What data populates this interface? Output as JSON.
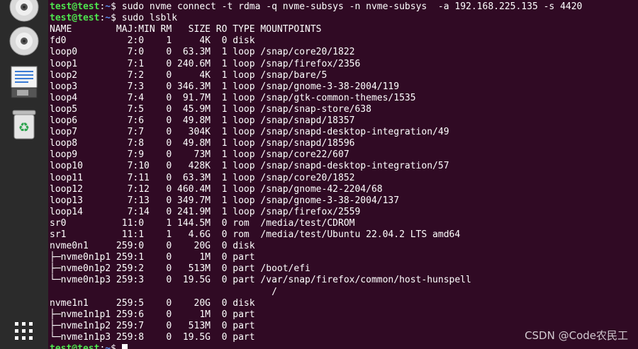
{
  "dock": {
    "items": [
      "optical-disc-icon",
      "optical-disc-icon",
      "disk-editor-icon",
      "trash-icon"
    ],
    "apps_grid_icon": "show-applications-icon"
  },
  "terminal": {
    "prompt_user": "test@test",
    "prompt_path": "~",
    "lines": [
      {
        "text": "sudo nvme connect -t rdma -q nvme-subsys -n nvme-subsys  -a 192.168.225.135 -s 4420",
        "prompt": true
      },
      {
        "text": "sudo lsblk",
        "prompt": true
      },
      {
        "text": "NAME        MAJ:MIN RM   SIZE RO TYPE MOUNTPOINTS"
      },
      {
        "text": "fd0           2:0    1     4K  0 disk"
      },
      {
        "text": "loop0         7:0    0  63.3M  1 loop /snap/core20/1822"
      },
      {
        "text": "loop1         7:1    0 240.6M  1 loop /snap/firefox/2356"
      },
      {
        "text": "loop2         7:2    0     4K  1 loop /snap/bare/5"
      },
      {
        "text": "loop3         7:3    0 346.3M  1 loop /snap/gnome-3-38-2004/119"
      },
      {
        "text": "loop4         7:4    0  91.7M  1 loop /snap/gtk-common-themes/1535"
      },
      {
        "text": "loop5         7:5    0  45.9M  1 loop /snap/snap-store/638"
      },
      {
        "text": "loop6         7:6    0  49.8M  1 loop /snap/snapd/18357"
      },
      {
        "text": "loop7         7:7    0   304K  1 loop /snap/snapd-desktop-integration/49"
      },
      {
        "text": "loop8         7:8    0  49.8M  1 loop /snap/snapd/18596"
      },
      {
        "text": "loop9         7:9    0    73M  1 loop /snap/core22/607"
      },
      {
        "text": "loop10        7:10   0   428K  1 loop /snap/snapd-desktop-integration/57"
      },
      {
        "text": "loop11        7:11   0  63.3M  1 loop /snap/core20/1852"
      },
      {
        "text": "loop12        7:12   0 460.4M  1 loop /snap/gnome-42-2204/68"
      },
      {
        "text": "loop13        7:13   0 349.7M  1 loop /snap/gnome-3-38-2004/137"
      },
      {
        "text": "loop14        7:14   0 241.9M  1 loop /snap/firefox/2559"
      },
      {
        "text": "sr0          11:0    1 144.5M  0 rom  /media/test/CDROM"
      },
      {
        "text": "sr1          11:1    1   4.6G  0 rom  /media/test/Ubuntu 22.04.2 LTS amd64"
      },
      {
        "text": "nvme0n1     259:0    0    20G  0 disk"
      },
      {
        "text": "├─nvme0n1p1 259:1    0     1M  0 part"
      },
      {
        "text": "├─nvme0n1p2 259:2    0   513M  0 part /boot/efi"
      },
      {
        "text": "└─nvme0n1p3 259:3    0  19.5G  0 part /var/snap/firefox/common/host-hunspell"
      },
      {
        "text": "                                        /"
      },
      {
        "text": "nvme1n1     259:5    0    20G  0 disk"
      },
      {
        "text": "├─nvme1n1p1 259:6    0     1M  0 part"
      },
      {
        "text": "├─nvme1n1p2 259:7    0   513M  0 part"
      },
      {
        "text": "└─nvme1n1p3 259:8    0  19.5G  0 part"
      },
      {
        "text": "",
        "prompt": true,
        "cursor": true
      }
    ]
  },
  "watermark": "CSDN @Code农民工",
  "colors": {
    "background": "#300a24",
    "prompt_user": "#4ee44e",
    "prompt_path": "#5a8ef0",
    "text": "#ffffff",
    "dock": "#2b2b2b"
  }
}
